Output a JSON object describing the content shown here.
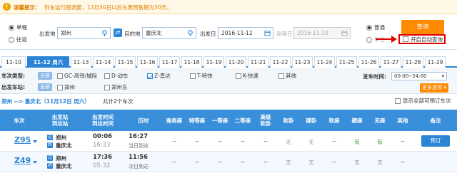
{
  "notice": {
    "label": "温馨提示：",
    "text": "列车运行图调整，12月30日以后车票预售期为30天。"
  },
  "search": {
    "trip_types": [
      {
        "label": "单程",
        "checked": true
      },
      {
        "label": "往返",
        "checked": false
      }
    ],
    "from_label": "出发地",
    "from_value": "郑州",
    "to_label": "目的地",
    "to_value": "重庆北",
    "depart_label": "出发日",
    "depart_value": "2016-11-12",
    "return_label": "返程日",
    "return_value": "2016-11-10",
    "ticket_types": [
      {
        "label": "普通",
        "checked": true
      },
      {
        "label": "学生",
        "checked": false
      }
    ],
    "query_label": "查询",
    "auto_query_label": "开启自动查询"
  },
  "dates": [
    "11-10",
    "11-12 周六",
    "11-13",
    "11-14",
    "11-15",
    "11-16",
    "11-17",
    "11-18",
    "11-19",
    "11-20",
    "11-21",
    "11-22",
    "11-23",
    "11-24",
    "11-25",
    "11-26",
    "11-27",
    "11-28",
    "11-29"
  ],
  "active_date_index": 1,
  "filters": {
    "type_label": "车次类型:",
    "station_label": "出发车站:",
    "all_label": "全部",
    "types": [
      {
        "label": "GC-高铁/城际",
        "checked": false
      },
      {
        "label": "D-动车",
        "checked": false
      },
      {
        "label": "Z-直达",
        "checked": true
      },
      {
        "label": "T-特快",
        "checked": false
      },
      {
        "label": "K-快速",
        "checked": false
      },
      {
        "label": "其他",
        "checked": false
      }
    ],
    "stations": [
      {
        "label": "郑州",
        "checked": false
      },
      {
        "label": "郑州东",
        "checked": false
      }
    ],
    "time_label": "发车时间:",
    "time_value": "00:00--24:00",
    "more_label": "更多选项"
  },
  "summary": {
    "route": "郑州 --> 重庆北（11月12日 周六）",
    "count": "共计2个车次",
    "show_all_label": "显示全部可预订车次"
  },
  "table": {
    "headers": [
      "车次",
      "出发站\n到达站",
      "出发时间\n到达时间",
      "历时",
      "商务座",
      "特等座",
      "一等座",
      "二等座",
      "高级\n软卧",
      "软卧",
      "硬卧",
      "软座",
      "硬座",
      "无座",
      "其他",
      "备注"
    ],
    "rows": [
      {
        "train": "Z95",
        "from_station": "郑州",
        "to_station": "重庆北",
        "from_badge": "过",
        "to_badge": "终",
        "depart": "00:06",
        "arrive": "16:33",
        "duration": "16:27",
        "duration_note": "当日到达",
        "seats": [
          "--",
          "--",
          "--",
          "--",
          "--",
          "无",
          "无",
          "--",
          "有",
          "有",
          "--"
        ],
        "action": "预订"
      },
      {
        "train": "Z49",
        "from_station": "郑州",
        "to_station": "重庆北",
        "from_badge": "过",
        "to_badge": "终",
        "depart": "17:36",
        "arrive": "05:32",
        "duration": "11:56",
        "duration_note": "次日到达",
        "seats": [
          "--",
          "--",
          "--",
          "--",
          "--",
          "无",
          "无",
          "--",
          "无",
          "无",
          "--"
        ],
        "action": ""
      }
    ]
  }
}
